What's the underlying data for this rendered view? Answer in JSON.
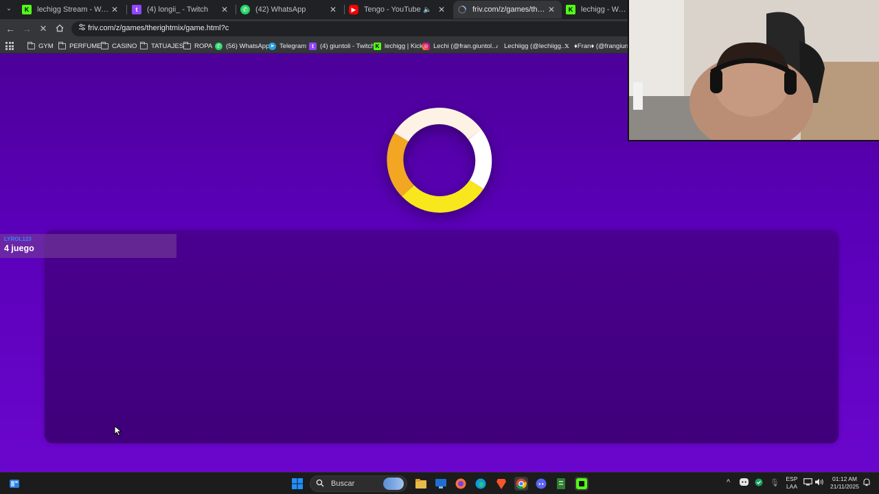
{
  "browser": {
    "tabs": [
      {
        "title": "lechigg Stream - Watch Live on",
        "favicon": "kick-icon",
        "color": "#53fc18",
        "active": false
      },
      {
        "title": "(4) longii_ - Twitch",
        "favicon": "twitch-icon",
        "color": "#9146ff",
        "active": false
      },
      {
        "title": "(42) WhatsApp",
        "favicon": "whatsapp-icon",
        "color": "#25d366",
        "active": false
      },
      {
        "title": "Tengo - YouTube",
        "favicon": "youtube-icon",
        "color": "#ff0000",
        "active": false,
        "audio": true
      },
      {
        "title": "friv.com/z/games/therightmix/g",
        "favicon": "loading-icon",
        "color": "#bdc1c6",
        "active": true
      },
      {
        "title": "lechigg - Watch clips",
        "favicon": "kick-icon",
        "color": "#53fc18",
        "active": false
      }
    ],
    "url": "friv.com/z/games/therightmix/game.html?c",
    "bookmarks": [
      {
        "label": "GYM",
        "icon": "folder-icon"
      },
      {
        "label": "PERFUME",
        "icon": "folder-icon"
      },
      {
        "label": "CASINO",
        "icon": "folder-icon"
      },
      {
        "label": "TATUAJES",
        "icon": "folder-icon"
      },
      {
        "label": "ROPA",
        "icon": "folder-icon"
      },
      {
        "label": "(56) WhatsApp",
        "icon": "whatsapp-icon"
      },
      {
        "label": "Telegram",
        "icon": "telegram-icon"
      },
      {
        "label": "(4) giuntoli - Twitch",
        "icon": "twitch-icon"
      },
      {
        "label": "lechigg | Kick",
        "icon": "kick-icon"
      },
      {
        "label": "Lechi (@fran.giuntol...",
        "icon": "instagram-icon"
      },
      {
        "label": "Lechiigg (@lechiigg...",
        "icon": "tiktok-icon"
      },
      {
        "label": "♦Fran♦ (@frangiunt...",
        "icon": "x-icon"
      }
    ]
  },
  "page": {
    "background": "#5a00b8",
    "loader_colors": [
      "#fdf2e4",
      "#ffffff",
      "#f7e71c",
      "#f2a622"
    ]
  },
  "chat": {
    "username": "LYROL123",
    "message": "4 juego"
  },
  "taskbar": {
    "search_placeholder": "Buscar",
    "lang_line1": "ESP",
    "lang_line2": "LAA",
    "time": "01:12 AM",
    "date": "21/11/2025"
  }
}
